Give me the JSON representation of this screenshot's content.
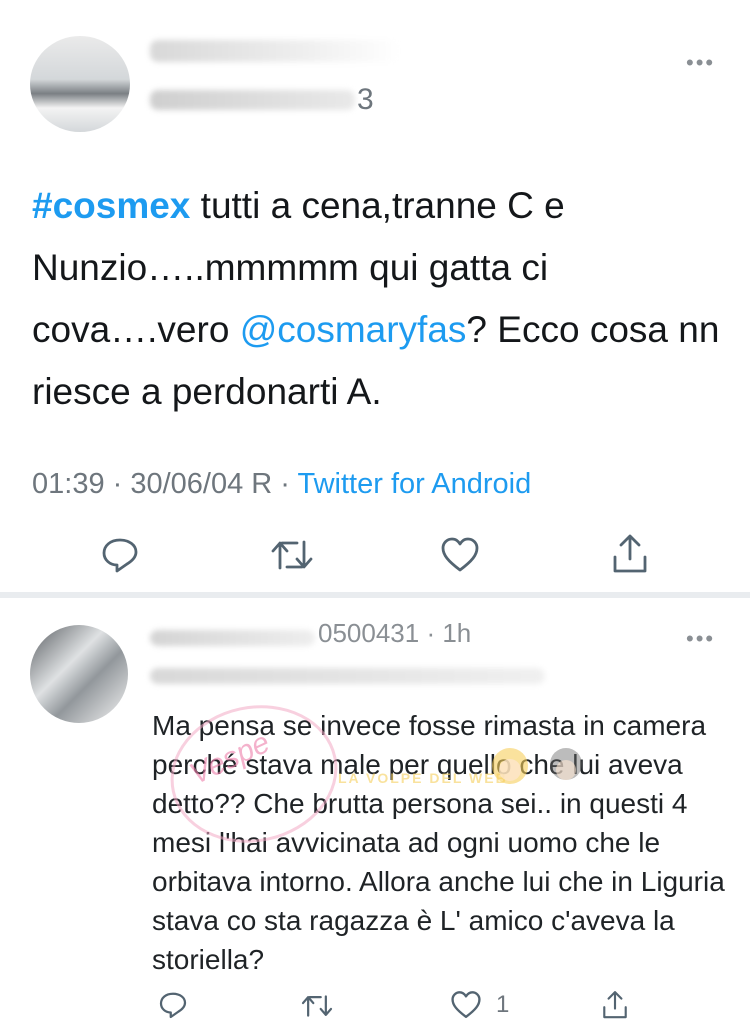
{
  "tweet": {
    "handle_suffix": "3",
    "text": {
      "hashtag": "#cosmex",
      "part1": " tutti a cena,tranne C e Nunzio…..mmmmm qui gatta ci cova….vero ",
      "mention": "@cosmaryfas",
      "part2": "? Ecco cosa nn riesce a perdonarti A."
    },
    "timestamp": "01:39 · 30/06/04 R",
    "separator": " · ",
    "source": "Twitter for Android"
  },
  "reply": {
    "header_visible": "0500431 · 1h",
    "text": "Ma pensa se invece fosse rimasta in camera perché stava male per quello che lui aveva detto?? Che brutta persona sei.. in questi 4 mesi l'hai avvicinata ad ogni uomo che le orbitava intorno. Allora anche lui che in Liguria stava co sta ragazza è L' amico c'aveva la storiella?",
    "like_count": "1"
  },
  "watermark": {
    "text": "Vespe",
    "banner": "LA VOLPE DEL WEB"
  },
  "colors": {
    "accent": "#1d9bf0",
    "meta_gray": "#6e767d",
    "icon_gray": "#536471"
  }
}
